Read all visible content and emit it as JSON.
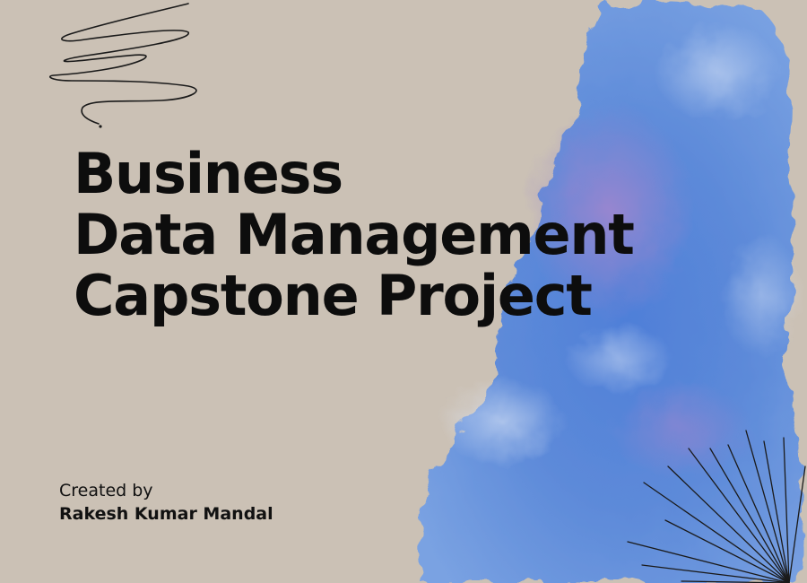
{
  "slide": {
    "title_lines": [
      "Business",
      "Data Management",
      "Capstone Project"
    ],
    "credit_label": "Created by",
    "author": "Rakesh Kumar Mandal"
  },
  "colors": {
    "background": "#cbc1b5",
    "watercolor_blue": "#5a86d6",
    "watercolor_purple": "#8f82c9",
    "text": "#0d0d0d"
  },
  "icons": [
    "scribble-icon",
    "starburst-lines-icon",
    "watercolor-blob"
  ]
}
